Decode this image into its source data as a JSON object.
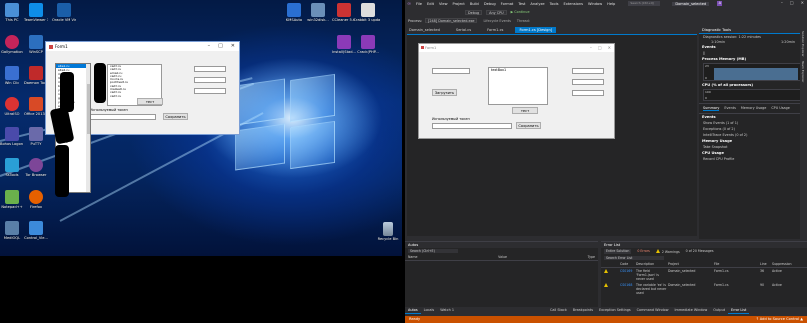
{
  "desktop": {
    "icons_left": [
      {
        "label": "This PC",
        "color": "#4a8fd6"
      },
      {
        "label": "Gallymotion",
        "color": "#c4245a"
      },
      {
        "label": "Win Clic",
        "color": "#3a6fd1"
      },
      {
        "label": "UltraISO",
        "color": "#d33"
      },
      {
        "label": "Bohos Logon Key",
        "color": "#4a4aaa"
      },
      {
        "label": "SsTools",
        "color": "#2a9fd6"
      },
      {
        "label": "Notepad++",
        "color": "#6ab04c"
      },
      {
        "label": "MediOQL",
        "color": "#5a7fa8"
      }
    ],
    "icons_col2": [
      {
        "label": "TeamViewer 13",
        "color": "#0e8ee9"
      },
      {
        "label": "WinSCP",
        "color": "#2c6fbf"
      },
      {
        "label": "Daemon Tools Shell",
        "color": "#c02a2a"
      },
      {
        "label": "Office 2013-20...",
        "color": "#d84a26"
      },
      {
        "label": "PuTTY",
        "color": "#6a6aaa"
      },
      {
        "label": "Tor Browser",
        "color": "#7d4698"
      },
      {
        "label": "Firefox",
        "color": "#e66000"
      },
      {
        "label": "Control_Vie...",
        "color": "#3c8adb"
      }
    ],
    "icons_col3": [
      {
        "label": "Oracle VM VirtualBox",
        "color": "#1a5ea8"
      }
    ],
    "icons_top": [
      {
        "label": "KMSAuto",
        "color": "#2a6fd1"
      },
      {
        "label": "win32disk...",
        "color": "#6a8fb8"
      },
      {
        "label": "CCleaner 5.62.7540",
        "color": "#c33"
      },
      {
        "label": "rabbit 3 updates",
        "color": "#ddd"
      }
    ],
    "icons_top2": [
      {
        "label": "Install(Stad...",
        "color": "#8b3ab8"
      },
      {
        "label": "Crack(PHP...",
        "color": "#8b3ab8"
      }
    ],
    "recycle_bin": "Recycle Bin",
    "form1": {
      "title": "Form1",
      "listbox_lines": [
        "сайт.ru",
        "сайт.ru",
        "email.ru",
        "сайт-ru",
        "почта.ru",
        "pochtsait.ru",
        "сайт.ru",
        "mailsait.ru",
        "сайт.ru",
        "сайт.ru"
      ],
      "button_test": "тест",
      "label_used": "Используемый токен",
      "button_save": "Сохранить"
    },
    "dropdown_lines": [
      "site1.ru",
      "site2.ru",
      "mail.ru",
      "list.ru",
      "inbox.ru",
      "bk.ru",
      "yandex.ru",
      "rambler.ru",
      "gmail.com",
      "yahoo.com",
      "site.ru",
      "site.ru",
      "site.ru",
      "site.ru",
      "site.ru",
      "site.ru",
      "site.ru",
      "site.ru",
      "site.ru",
      "site.ru",
      "site.ru",
      "site.ru",
      "site.ru",
      "site.ru",
      "site.ru",
      "site.ru",
      "site.ru",
      "site.ru",
      "site.ru",
      "site.ru"
    ]
  },
  "vs": {
    "menu": [
      "File",
      "Edit",
      "View",
      "Project",
      "Build",
      "Debug",
      "Format",
      "Test",
      "Analyze",
      "Tools",
      "Extensions",
      "Window",
      "Help"
    ],
    "search_placeholder": "Search (Ctrl+Q)",
    "project_name": "Domain_selected",
    "avatar": "A",
    "toolbar": {
      "config": "Debug",
      "platform": "Any CPU",
      "start": "▶ Continue"
    },
    "process": {
      "label": "Process:",
      "value": "[248] Domain_selected.exe",
      "lifecycle": "Lifecycle Events",
      "thread": "Thread:"
    },
    "tabs": [
      "Domain_selected",
      "Serial.cs",
      "Form1.cs",
      "Form1.cs [Design]"
    ],
    "form": {
      "title": "Form1",
      "textbox_label": "textBox1",
      "button_load": "Загрузить",
      "button_test": "тест",
      "label_used": "Используемый токен",
      "button_save": "Сохранить"
    },
    "diag": {
      "title": "Diagnostic Tools",
      "session": "Diagnostics session: 1:22 minutes",
      "time_a": "1:10min",
      "time_b": "1:20min",
      "events": "Events",
      "memory": "Process Memory (MB)",
      "mem_max": "23",
      "mem_min": "0",
      "cpu": "CPU (% of all processors)",
      "cpu_max": "100",
      "cpu_min": "0",
      "tabs": [
        "Summary",
        "Events",
        "Memory Usage",
        "CPU Usage"
      ],
      "ev_section": "Events",
      "ev_items": [
        "Show Events (1 of 1)",
        "Exceptions (0 of 2)",
        "IntelliTrace Events (0 of 2)"
      ],
      "mem_section": "Memory Usage",
      "mem_item": "Take Snapshot",
      "cpu_section": "CPU Usage",
      "cpu_item": "Record CPU Profile"
    },
    "side_tabs": [
      "Solution Explorer",
      "Team Explorer"
    ],
    "autos": {
      "title": "Autos",
      "search": "Search (Ctrl+E)",
      "cols": [
        "Name",
        "Value",
        "Type"
      ]
    },
    "errors": {
      "title": "Error List",
      "scope": "Entire Solution",
      "errors": "0 Errors",
      "warnings": "2 Warnings",
      "messages": "0 of 20 Messages",
      "search": "Search Error List",
      "cols": [
        "Code",
        "Description",
        "Project",
        "File",
        "Line",
        "Suppression"
      ],
      "rows": [
        {
          "code": "CS0169",
          "desc": "The field 'Form1.json' is never used",
          "project": "Domain_selected",
          "file": "Form1.cs",
          "line": "36",
          "state": "Active"
        },
        {
          "code": "CS0168",
          "desc": "The variable 'ex' is declared but never used",
          "project": "Domain_selected",
          "file": "Form1.cs",
          "line": "90",
          "state": "Active"
        }
      ]
    },
    "bottom_tabs_left": [
      "Autos",
      "Locals",
      "Watch 1"
    ],
    "bottom_tabs_right": [
      "Call Stack",
      "Breakpoints",
      "Exception Settings",
      "Command Window",
      "Immediate Window",
      "Output",
      "Error List"
    ],
    "status": {
      "left": "Ready",
      "right": "↑ Add to Source Control ▲"
    }
  }
}
